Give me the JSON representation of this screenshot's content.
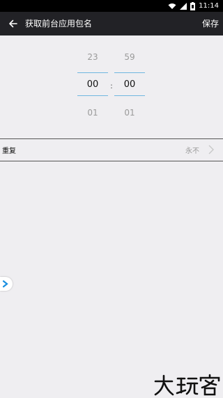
{
  "status_bar": {
    "time": "11:14"
  },
  "app_bar": {
    "title": "获取前台应用包名",
    "save_label": "保存"
  },
  "time_picker": {
    "hour": {
      "prev": "23",
      "current": "00",
      "next": "01"
    },
    "minute": {
      "prev": "59",
      "current": "00",
      "next": "01"
    },
    "separator": ":"
  },
  "repeat": {
    "label": "重复",
    "value": "永不"
  },
  "icons": {
    "back": "back-arrow-icon",
    "repeat_chevron": "chevron-right-icon",
    "floating": "chevron-right-icon",
    "wifi": "wifi-icon",
    "signal": "signal-icon",
    "battery": "battery-icon"
  },
  "watermark": "大玩客",
  "colors": {
    "accent": "#6fb6e0",
    "appbar": "#222226",
    "background": "#efeef1"
  }
}
